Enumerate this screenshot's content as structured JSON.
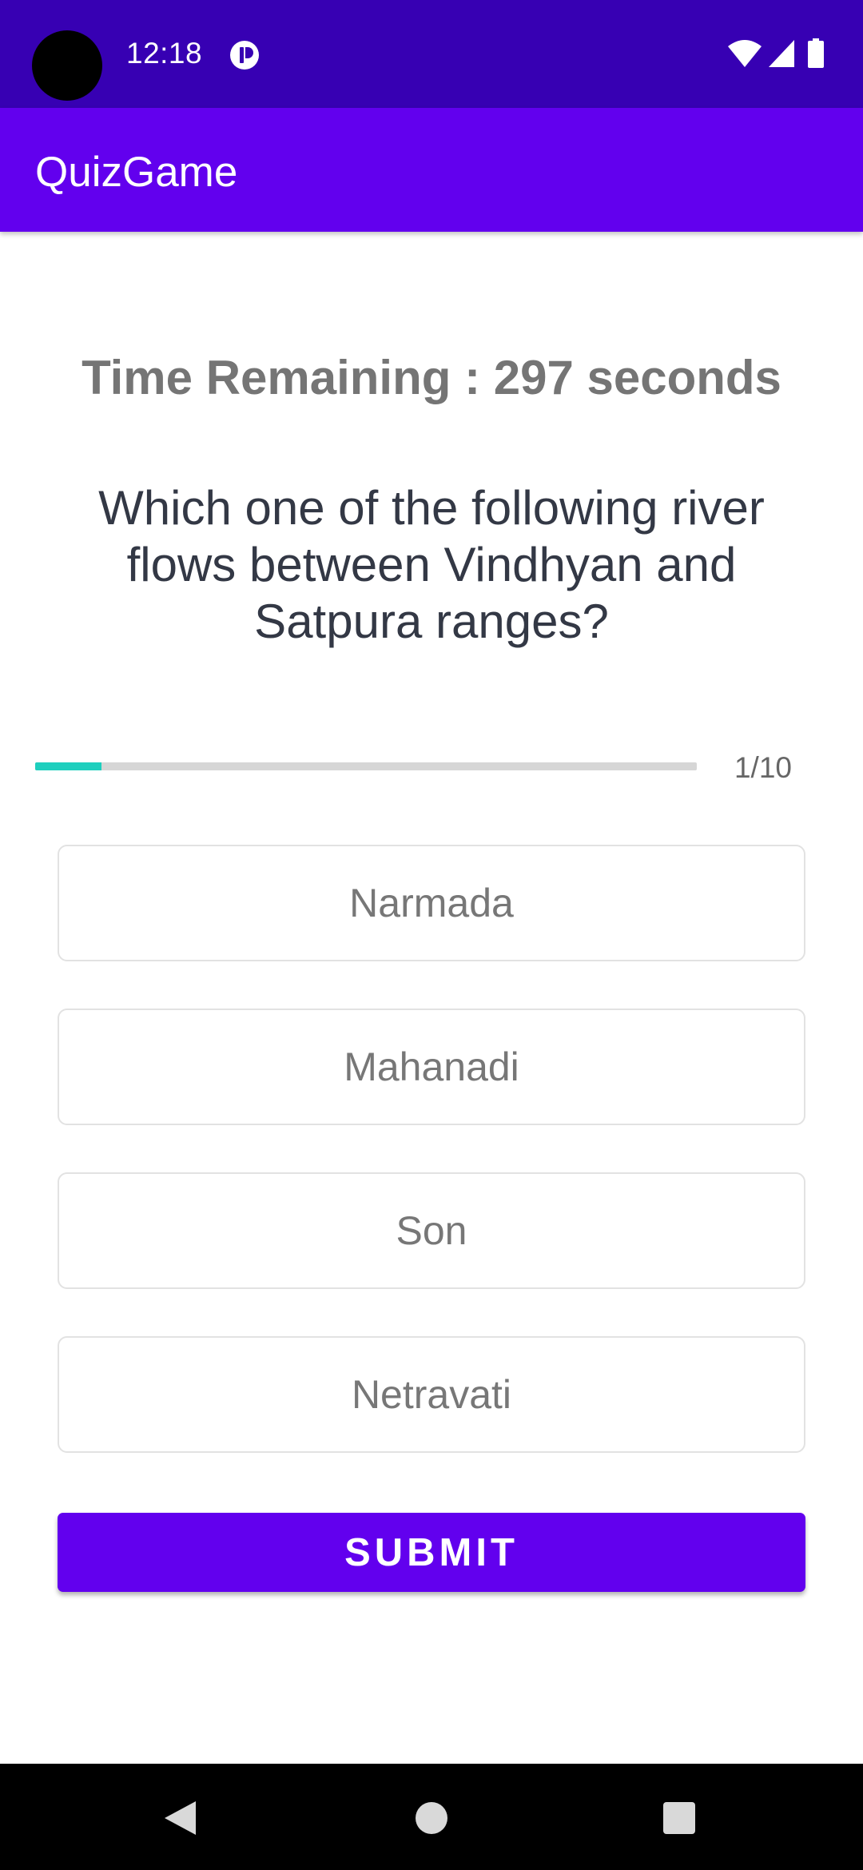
{
  "status_bar": {
    "time": "12:18",
    "icons": [
      "camera-cutout",
      "app-notification-icon",
      "wifi-icon",
      "signal-icon",
      "battery-icon"
    ],
    "background": "#3700b3"
  },
  "app_bar": {
    "title": "QuizGame",
    "background": "#6200ee"
  },
  "quiz": {
    "timer_text": "Time Remaining : 297 seconds",
    "question": "Which one of the following river flows between Vindhyan and Satpura ranges?",
    "progress": {
      "current": 1,
      "total": 10,
      "label": "1/10",
      "fraction": 0.1,
      "color": "#1ecfbe"
    },
    "options": [
      {
        "label": "Narmada"
      },
      {
        "label": "Mahanadi"
      },
      {
        "label": "Son"
      },
      {
        "label": "Netravati"
      }
    ],
    "submit_label": "SUBMIT"
  },
  "nav_bar": {
    "buttons": [
      "back-icon",
      "home-icon",
      "recents-icon"
    ]
  }
}
